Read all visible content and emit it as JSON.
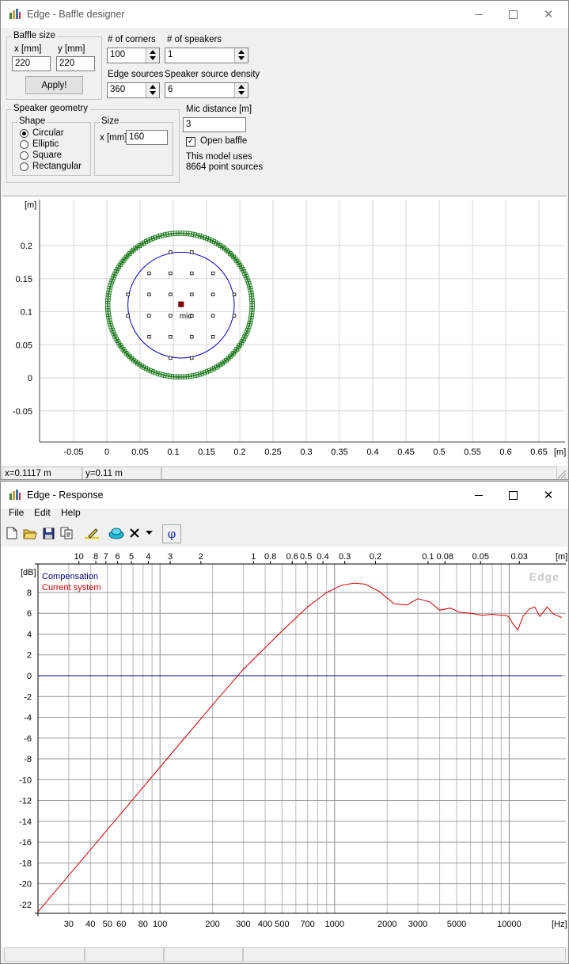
{
  "baffle": {
    "title": "Edge - Baffle designer",
    "baffle_size": {
      "title": "Baffle size",
      "x_label": "x [mm]",
      "y_label": "y [mm]",
      "x_value": "220",
      "y_value": "220",
      "apply_label": "Apply!"
    },
    "corners": {
      "label": "# of corners",
      "value": "100"
    },
    "speakers": {
      "label": "# of speakers",
      "value": "1"
    },
    "edge_sources": {
      "label": "Edge sources",
      "value": "360"
    },
    "density": {
      "label": "Speaker source density",
      "value": "6"
    },
    "speaker_geometry": {
      "title": "Speaker geometry",
      "shape_title": "Shape",
      "shapes": [
        "Circular",
        "Elliptic",
        "Square",
        "Rectangular"
      ],
      "selected": "Circular",
      "size_title": "Size",
      "size_x_label": "x [mm]",
      "size_x_value": "160"
    },
    "mic": {
      "label": "Mic distance [m]",
      "value": "3",
      "open_baffle_label": "Open baffle",
      "open_baffle_checked": true,
      "info_line1": "This model uses",
      "info_line2": "8664 point sources"
    },
    "plot": {
      "unit_label": "[m]",
      "x_ticks": [
        "-0.05",
        "0",
        "0.05",
        "0.1",
        "0.15",
        "0.2",
        "0.25",
        "0.3",
        "0.35",
        "0.4",
        "0.45",
        "0.5",
        "0.55",
        "0.6",
        "0.65"
      ],
      "y_ticks": [
        "0.2",
        "0.15",
        "0.1",
        "0.05",
        "0",
        "-0.05"
      ],
      "x_ticks_num": [
        -0.05,
        0,
        0.05,
        0.1,
        0.15,
        0.2,
        0.25,
        0.3,
        0.35,
        0.4,
        0.45,
        0.5,
        0.55,
        0.6,
        0.65
      ],
      "y_ticks_num": [
        0.2,
        0.15,
        0.1,
        0.05,
        0,
        -0.05
      ],
      "baffle": {
        "cx": 0.11,
        "cy": 0.11,
        "r": 0.11,
        "edge_sources": 360
      },
      "speaker": {
        "cx": 0.1117,
        "cy": 0.11,
        "r": 0.08
      },
      "mic_label": "mic",
      "colors": {
        "baffle": "#1f7a1f",
        "speaker": "#0000c0",
        "mic": "#8b0000"
      }
    },
    "status": {
      "x": "x=0.1117 m",
      "y": "y=0.11 m"
    }
  },
  "response": {
    "title": "Edge - Response",
    "menu": [
      "File",
      "Edit",
      "Help"
    ],
    "toolbar_icons": [
      "new-file-icon",
      "open-folder-icon",
      "save-icon",
      "copy-icon",
      "pen-icon",
      "speaker-icon",
      "delete-icon",
      "dropdown-icon",
      "phase-icon"
    ],
    "phase_symbol": "φ",
    "watermark": "Edge"
  },
  "chart_data": {
    "type": "line",
    "title": "",
    "xlabel": "[Hz]",
    "ylabel": "[dB]",
    "x_scale": "log",
    "xlim": [
      20,
      20000
    ],
    "ylim": [
      -23,
      10
    ],
    "grid": true,
    "legend_position": "top-left",
    "x_ticks": [
      30,
      40,
      50,
      60,
      80,
      100,
      200,
      300,
      400,
      500,
      700,
      1000,
      2000,
      3000,
      5000,
      10000
    ],
    "x_tick_labels": [
      "30",
      "40",
      "50",
      "60",
      "80",
      "100",
      "200",
      "300",
      "400",
      "500",
      "700",
      "1000",
      "2000",
      "3000",
      "5000",
      "10000"
    ],
    "y_ticks": [
      8,
      6,
      4,
      2,
      0,
      -2,
      -4,
      -6,
      -8,
      -10,
      -12,
      -14,
      -16,
      -18,
      -20,
      -22
    ],
    "y_tick_labels": [
      "8",
      "6",
      "4",
      "2",
      "0",
      "-2",
      "-4",
      "-6",
      "-8",
      "-10",
      "-12",
      "-14",
      "-16",
      "-18",
      "-20",
      "-22"
    ],
    "top_axis_label": "[m]",
    "top_axis_values": [
      10,
      8,
      7,
      6,
      5,
      4,
      3,
      2,
      1,
      0.8,
      0.6,
      0.5,
      0.4,
      0.3,
      0.2,
      0.1,
      0.08,
      0.05,
      0.03
    ],
    "top_axis_labels": [
      "10",
      "8",
      "7",
      "6",
      "5",
      "4",
      "3",
      "2",
      "1",
      "0.8",
      "0.6",
      "0.5",
      "0.4",
      "0.3",
      "0.2",
      "0.1",
      "0.08",
      "0.05",
      "0.03"
    ],
    "series": [
      {
        "name": "Compensation",
        "color": "#000080",
        "x": [
          20,
          20000
        ],
        "y": [
          0,
          0
        ]
      },
      {
        "name": "Current system",
        "color": "#cc0000",
        "x": [
          20,
          50,
          100,
          200,
          300,
          500,
          700,
          900,
          1100,
          1300,
          1500,
          1800,
          2200,
          2600,
          3000,
          3500,
          4000,
          4600,
          5200,
          6000,
          7000,
          8000,
          9000,
          9600,
          10000,
          10500,
          11200,
          12000,
          13000,
          14000,
          15000,
          16500,
          18000,
          20000
        ],
        "y": [
          -22.7,
          -14.8,
          -8.8,
          -2.8,
          0.6,
          4.3,
          6.6,
          8.0,
          8.7,
          8.9,
          8.8,
          8.1,
          6.9,
          6.8,
          7.4,
          7.1,
          6.3,
          6.5,
          6.1,
          6.0,
          5.8,
          5.9,
          5.8,
          5.8,
          5.6,
          5.0,
          4.4,
          5.7,
          6.4,
          6.6,
          5.7,
          6.6,
          5.9,
          5.6
        ]
      }
    ]
  },
  "response_status": [
    "",
    "",
    "",
    ""
  ]
}
